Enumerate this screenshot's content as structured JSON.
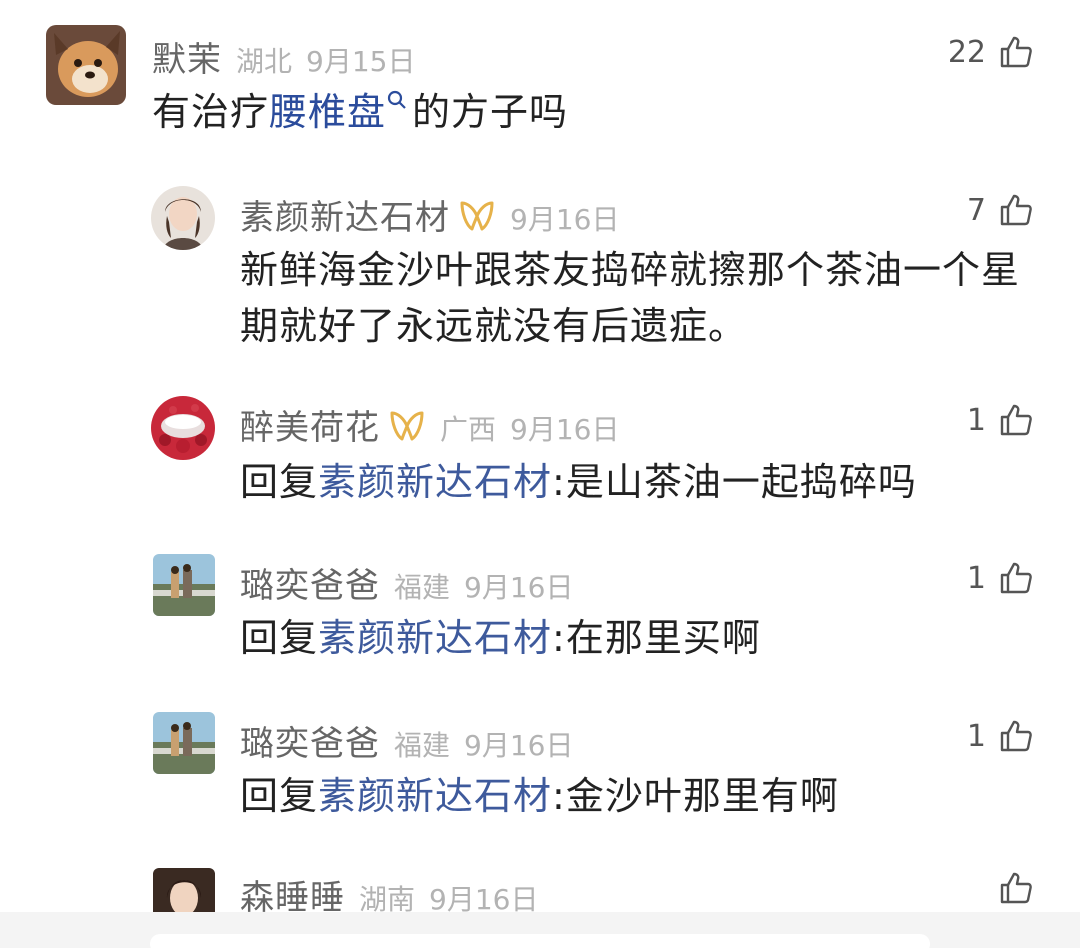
{
  "comments": [
    {
      "user": "默茉",
      "location": "湖北",
      "date": "9月15日",
      "likes": "22",
      "text_before": "有治疗",
      "link": "腰椎盘",
      "text_after": "的方子吗"
    },
    {
      "user": "素颜新达石材",
      "date": "9月16日",
      "likes": "7",
      "line1": "新鲜海金沙叶跟茶友捣碎就擦那个茶油一个星",
      "line2": "期就好了永远就没有后遗症。"
    },
    {
      "user": "醉美荷花",
      "location": "广西",
      "date": "9月16日",
      "likes": "1",
      "reply_prefix": "回复",
      "reply_to": "素颜新达石材",
      "text": ":是山茶油一起捣碎吗"
    },
    {
      "user": "璐奕爸爸",
      "location": "福建",
      "date": "9月16日",
      "likes": "1",
      "reply_prefix": "回复",
      "reply_to": "素颜新达石材",
      "text": ":在那里买啊"
    },
    {
      "user": "璐奕爸爸",
      "location": "福建",
      "date": "9月16日",
      "likes": "1",
      "reply_prefix": "回复",
      "reply_to": "素颜新达石材",
      "text": ":金沙叶那里有啊"
    },
    {
      "user": "森睡睡",
      "location": "湖南",
      "date": "9月16日"
    }
  ],
  "icons": {
    "like": "thumbs-up-icon",
    "search": "search-icon",
    "badge": "gold-ribbon-badge-icon"
  },
  "colors": {
    "link": "#2b4c9c",
    "badge": "#e6b24a",
    "meta": "#b3b3b3"
  }
}
